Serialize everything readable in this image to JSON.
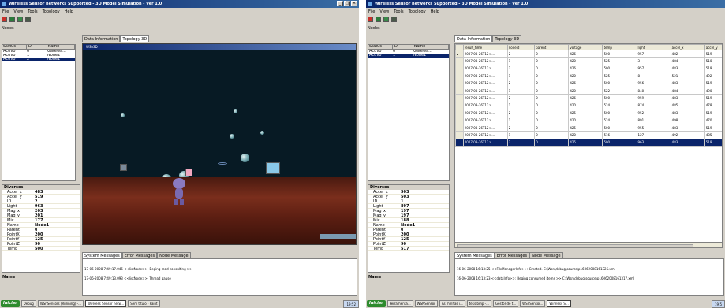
{
  "left": {
    "title": "Wireless Sensor networks Supported - 3D Model Simulation - Ver 1.0",
    "menu": [
      "File",
      "View",
      "Tools",
      "Topology",
      "Help"
    ],
    "nodes_label": "Nodes",
    "nodes_cols": [
      "Status",
      "ID",
      "Name"
    ],
    "nodes": [
      [
        "Activo",
        "0",
        "Gatewa..."
      ],
      [
        "Activo",
        "1",
        "Node2"
      ],
      [
        "Activo",
        "2",
        "Node1"
      ]
    ],
    "tabs": [
      "Data Information",
      "Topology 3D"
    ],
    "view_title": "WSn3D",
    "props_cat": "Diversos",
    "props": [
      [
        "Accel_x",
        "483"
      ],
      [
        "Accel_y",
        "519"
      ],
      [
        "ID",
        "2"
      ],
      [
        "Light",
        "963"
      ],
      [
        "Mag_x",
        "203"
      ],
      [
        "Mag_y",
        "201"
      ],
      [
        "Mic",
        "177"
      ],
      [
        "Name",
        "Node1"
      ],
      [
        "Parent",
        "0"
      ],
      [
        "PointX",
        "200"
      ],
      [
        "PointY",
        "125"
      ],
      [
        "PointZ",
        "90"
      ],
      [
        "Temp",
        "500"
      ]
    ],
    "desc": "Name",
    "msg_tabs": [
      "System Messages",
      "Error Messages",
      "Node Message"
    ],
    "messages": [
      "17-06-2008 7:49:17.046 <<listNode>>: Beging read consulting >>",
      "17-06-2008 7:49:13.093 <<listNode>>: Thread pause"
    ],
    "task": {
      "start": "Iniciar",
      "items": [
        "Debug",
        "WSnSensors (Running) -...",
        "Wireless Sensor netw...",
        "Sem título - Paint"
      ],
      "clock": "19:52"
    }
  },
  "right": {
    "title": "Wireless Sensor networks Supported - 3D Model Simulation - Ver 1.0",
    "menu": [
      "File",
      "View",
      "Tools",
      "Topology",
      "Help"
    ],
    "nodes_label": "Nodes",
    "nodes_cols": [
      "Status",
      "ID",
      "Name"
    ],
    "nodes": [
      [
        "Activo",
        "0",
        "Gatewa..."
      ],
      [
        "Activo",
        "1",
        "Node1"
      ]
    ],
    "tabs": [
      "Data Information",
      "Topology 3D"
    ],
    "grid_cols": [
      "result_time",
      "nodeid",
      "parent",
      "voltage",
      "temp",
      "light",
      "accel_x",
      "accel_y"
    ],
    "grid_rows": [
      [
        "2007-03-26T12:4...",
        "2",
        "0",
        "426",
        "500",
        "957",
        "482",
        "519"
      ],
      [
        "2007-03-26T12:4...",
        "1",
        "0",
        "420",
        "525",
        "3",
        "484",
        "510"
      ],
      [
        "2007-03-26T12:4...",
        "2",
        "0",
        "426",
        "500",
        "957",
        "483",
        "519"
      ],
      [
        "2007-03-26T12:4...",
        "1",
        "0",
        "420",
        "525",
        "8",
        "521",
        "492"
      ],
      [
        "2007-03-26T12:4...",
        "2",
        "0",
        "426",
        "500",
        "956",
        "483",
        "519"
      ],
      [
        "2007-03-26T12:4...",
        "1",
        "0",
        "420",
        "522",
        "840",
        "484",
        "490"
      ],
      [
        "2007-03-26T12:4...",
        "2",
        "0",
        "426",
        "500",
        "959",
        "483",
        "519"
      ],
      [
        "2007-03-26T12:4...",
        "1",
        "0",
        "420",
        "524",
        "874",
        "485",
        "478"
      ],
      [
        "2007-03-26T12:4...",
        "2",
        "0",
        "425",
        "500",
        "952",
        "483",
        "519"
      ],
      [
        "2007-03-26T12:4...",
        "1",
        "0",
        "420",
        "524",
        "891",
        "498",
        "470"
      ],
      [
        "2007-03-26T12:4...",
        "2",
        "0",
        "425",
        "500",
        "955",
        "483",
        "519"
      ],
      [
        "2007-03-26T12:4...",
        "1",
        "0",
        "420",
        "516",
        "127",
        "492",
        "485"
      ],
      [
        "2007-03-26T12:4...",
        "2",
        "0",
        "425",
        "500",
        "963",
        "483",
        "519"
      ]
    ],
    "props_cat": "Diversos",
    "props": [
      [
        "Accel_x",
        "503"
      ],
      [
        "Accel_y",
        "503"
      ],
      [
        "ID",
        "1"
      ],
      [
        "Light",
        "897"
      ],
      [
        "Mag_x",
        "197"
      ],
      [
        "Mag_y",
        "197"
      ],
      [
        "Mic",
        "188"
      ],
      [
        "Name",
        "Node1"
      ],
      [
        "Parent",
        "0"
      ],
      [
        "PointX",
        "200"
      ],
      [
        "PointY",
        "125"
      ],
      [
        "PointZ",
        "90"
      ],
      [
        "Temp",
        "517"
      ]
    ],
    "desc": "Name",
    "msg_tabs": [
      "System Messages",
      "Error Messages",
      "Node Message"
    ],
    "messages": [
      "16-06-2008 16:13:25 <<FileManagerInfo>>: Created. C:\\Wsn\\debug\\source\\p16062008161325.xml",
      "16-06-2008 16:13:23 <<dataInfo>>: Beging consumed items >> C:\\Wsn\\debug\\source\\p16062008161317.xml"
    ],
    "task": {
      "start": "Iniciar",
      "items": [
        "Ferramenta...",
        "WSNSensor",
        "As minhas i...",
        "teks.bmp -...",
        "Gestor de t...",
        "WSnSensor...",
        "Wireless S..."
      ],
      "clock": "19:5"
    }
  }
}
